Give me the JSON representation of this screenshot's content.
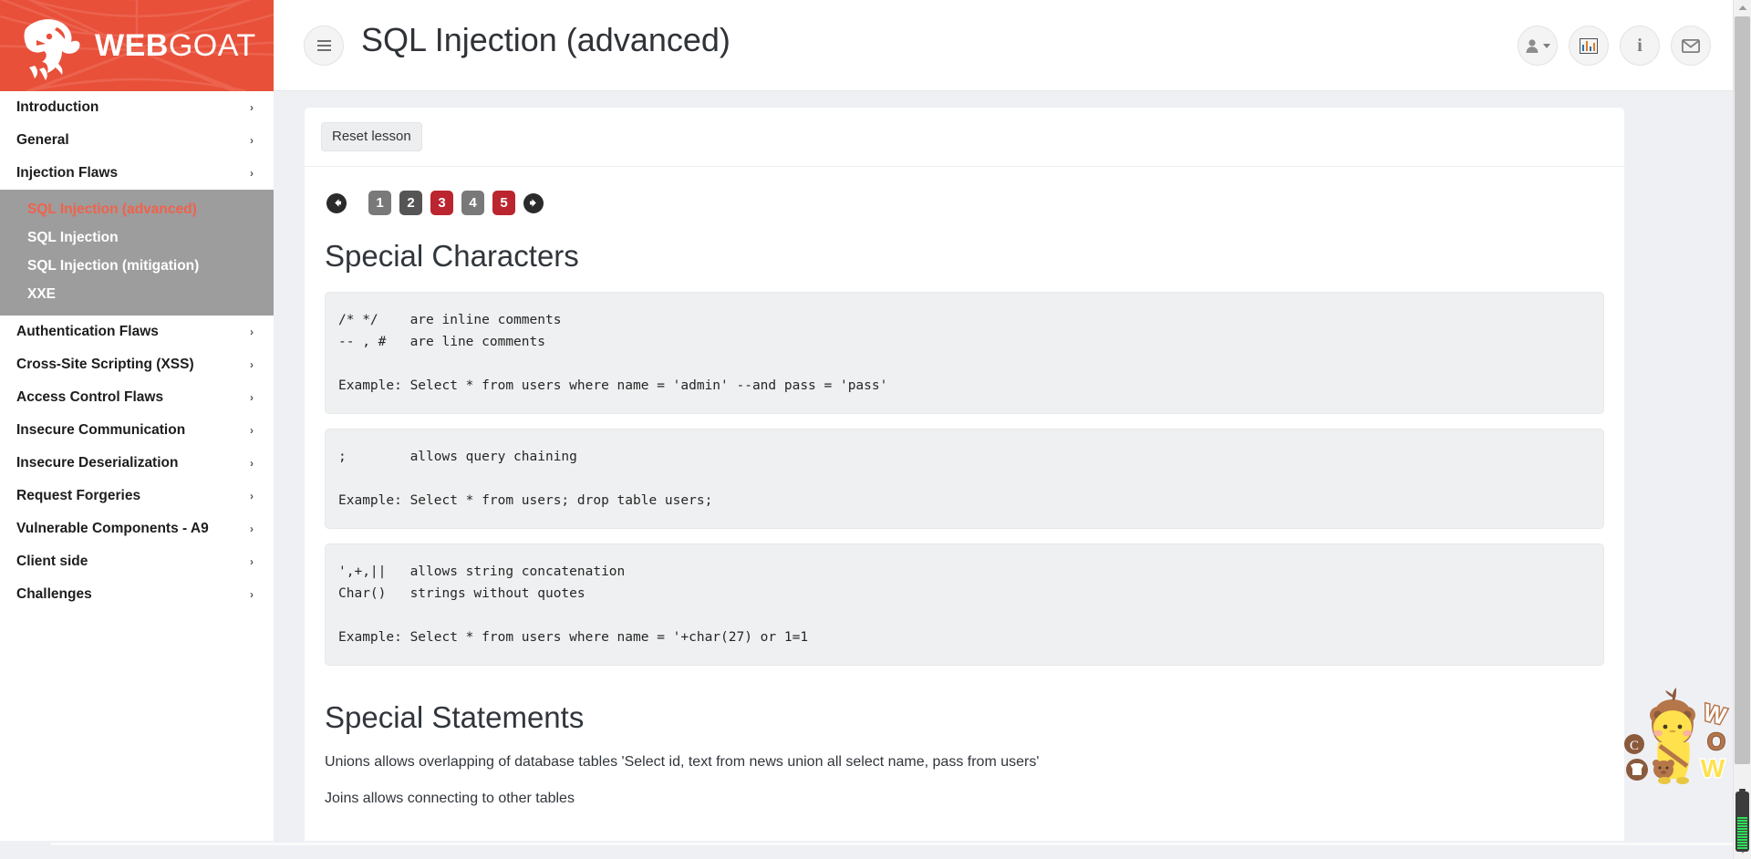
{
  "brand": {
    "text_bold": "WEB",
    "text_light": "GOAT",
    "logo_icon": "goat-head-icon",
    "background_color": "#e8503a"
  },
  "sidebar": {
    "items": [
      {
        "label": "Introduction",
        "chevron": "›",
        "expanded": false
      },
      {
        "label": "General",
        "chevron": "›",
        "expanded": false
      },
      {
        "label": "Injection Flaws",
        "chevron": "›",
        "expanded": true
      },
      {
        "label": "Authentication Flaws",
        "chevron": "›",
        "expanded": false
      },
      {
        "label": "Cross-Site Scripting (XSS)",
        "chevron": "›",
        "expanded": false
      },
      {
        "label": "Access Control Flaws",
        "chevron": "›",
        "expanded": false
      },
      {
        "label": "Insecure Communication",
        "chevron": "›",
        "expanded": false
      },
      {
        "label": "Insecure Deserialization",
        "chevron": "›",
        "expanded": false
      },
      {
        "label": "Request Forgeries",
        "chevron": "›",
        "expanded": false
      },
      {
        "label": "Vulnerable Components - A9",
        "chevron": "›",
        "expanded": false
      },
      {
        "label": "Client side",
        "chevron": "›",
        "expanded": false
      },
      {
        "label": "Challenges",
        "chevron": "›",
        "expanded": false
      }
    ],
    "submenu": {
      "items": [
        {
          "label": "SQL Injection (advanced)",
          "active": true
        },
        {
          "label": "SQL Injection",
          "active": false
        },
        {
          "label": "SQL Injection (mitigation)",
          "active": false
        },
        {
          "label": "XXE",
          "active": false
        }
      ],
      "background_color": "#9d9d9d",
      "active_color": "#f1624b"
    }
  },
  "header": {
    "menu_toggle_icon": "hamburger-icon",
    "title": "SQL Injection (advanced)",
    "tools": [
      {
        "icon": "user-icon",
        "has_caret": true
      },
      {
        "icon": "bar-chart-icon",
        "has_caret": false
      },
      {
        "icon": "info-icon",
        "label": "i",
        "has_caret": false
      },
      {
        "icon": "envelope-icon",
        "has_caret": false
      }
    ]
  },
  "main": {
    "reset_button_label": "Reset lesson",
    "pager": {
      "prev_icon": "arrow-left-icon",
      "next_icon": "arrow-right-icon",
      "pages": [
        {
          "label": "1",
          "state": "visited"
        },
        {
          "label": "2",
          "state": "current"
        },
        {
          "label": "3",
          "state": "incomplete"
        },
        {
          "label": "4",
          "state": "visited"
        },
        {
          "label": "5",
          "state": "incomplete"
        }
      ],
      "colors": {
        "visited": "#797979",
        "current": "#555555",
        "incomplete": "#bb2530"
      }
    },
    "sections": [
      {
        "heading": "Special Characters",
        "code_blocks": [
          "/* */    are inline comments\n-- , #   are line comments\n\nExample: Select * from users where name = 'admin' --and pass = 'pass'",
          ";        allows query chaining\n\nExample: Select * from users; drop table users;",
          "',+,||   allows string concatenation\nChar()   strings without quotes\n\nExample: Select * from users where name = '+char(27) or 1=1"
        ]
      },
      {
        "heading": "Special Statements",
        "paragraphs": [
          "Unions allows overlapping of database tables 'Select id, text from news union all select name, pass from users'",
          "Joins allows connecting to other tables"
        ]
      }
    ]
  },
  "overlay": {
    "mascot_icon": "bear-mascot-sticker",
    "mascot_text": "WOW",
    "battery_icon": "battery-icon"
  },
  "scrollbar": {
    "up_icon": "scroll-up-arrow-icon",
    "down_icon": "scroll-down-arrow-icon"
  }
}
